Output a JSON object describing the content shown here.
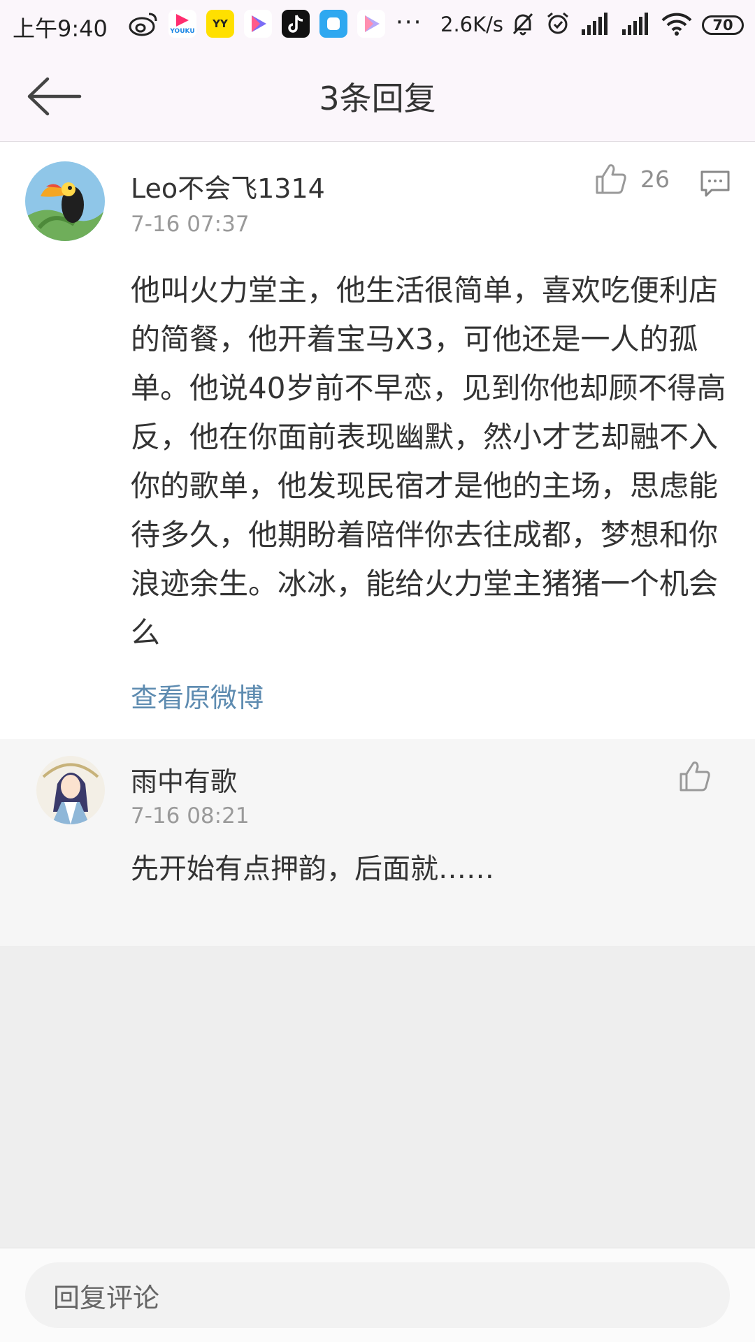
{
  "status_bar": {
    "time": "上午9:40",
    "network_speed": "2.6K/s",
    "battery": "70",
    "app_icons": [
      "weibo-icon",
      "youku-icon",
      "yy-icon",
      "video-icon",
      "tiktok-icon",
      "browser-icon",
      "video-icon"
    ],
    "youku_label": "YOUKU",
    "yy_label": "YY",
    "more": "···"
  },
  "header": {
    "title": "3条回复"
  },
  "main_comment": {
    "username": "Leo不会飞1314",
    "time": "7-16 07:37",
    "likes": "26",
    "text": "他叫火力堂主，他生活很简单，喜欢吃便利店的简餐，他开着宝马X3，可他还是一人的孤单。他说40岁前不早恋，见到你他却顾不得高反，他在你面前表现幽默，然小才艺却融不入你的歌单，他发现民宿才是他的主场，思虑能待多久，他期盼着陪伴你去往成都，梦想和你浪迹余生。冰冰，能给火力堂主猪猪一个机会么",
    "view_original": "查看原微博"
  },
  "reply": {
    "username": "雨中有歌",
    "time": "7-16 08:21",
    "text": "先开始有点押韵，后面就……"
  },
  "bottom": {
    "input_placeholder": "回复评论"
  },
  "colors": {
    "link": "#5d8bb0",
    "header_bg": "#fbf6fb",
    "reply_bg": "#f6f6f6",
    "filler_bg": "#eeeeee"
  }
}
